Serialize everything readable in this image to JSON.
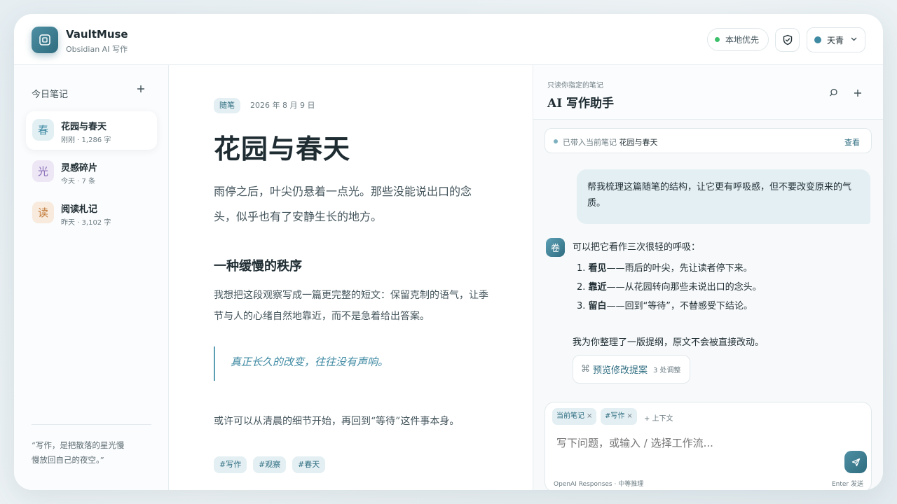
{
  "app": {
    "name": "VaultMuse",
    "subtitle": "Obsidian AI 写作",
    "local_first_label": "本地优先",
    "theme_label": "天青"
  },
  "colors": {
    "accent": "#2f6d80",
    "status_green": "#3cbf6a",
    "tag_bg": "#e3eff3"
  },
  "sidebar": {
    "title": "今日笔记",
    "add_icon": "plus-icon",
    "items": [
      {
        "badge": "春",
        "title": "花园与春天",
        "meta": "刚刚 · 1,286 字",
        "badge_color": "#3f8aa3",
        "badge_bg": "#e2f0f4"
      },
      {
        "badge": "光",
        "title": "灵感碎片",
        "meta": "今天 · 7 条",
        "badge_color": "#8a6fb8",
        "badge_bg": "#ede6f5"
      },
      {
        "badge": "读",
        "title": "阅读札记",
        "meta": "昨天 · 3,102 字",
        "badge_color": "#c27a3a",
        "badge_bg": "#f8eadc"
      }
    ],
    "quote": "“写作，是把散落的星光慢慢放回自己的夜空。”"
  },
  "editor": {
    "category": "随笔",
    "date": "2026 年 8 月 9 日",
    "title": "花园与春天",
    "paragraph1": "雨停之后，叶尖仍悬着一点光。那些没能说出口的念头，似乎也有了安静生长的地方。",
    "heading2": "一种缓慢的秩序",
    "paragraph2": "我想把这段观察写成一篇更完整的短文：保留克制的语气，让季节与人的心绪自然地靠近，而不是急着给出答案。",
    "quote": "真正长久的改变，往往没有声响。",
    "paragraph3": "或许可以从清晨的细节开始，再回到“等待”这件事本身。",
    "tags": [
      "#写作",
      "#观察",
      "#春天"
    ]
  },
  "ai_panel": {
    "subtitle": "只读你指定的笔记",
    "title": "AI 写作助手",
    "context_prefix": "已带入当前笔记",
    "context_note": "花园与春天",
    "view_label": "查看",
    "user_message": "帮我梳理这篇随笔的结构，让它更有呼吸感，但不要改变原来的气质。",
    "bot_avatar": "卷",
    "bot_intro": "可以把它看作三次很轻的呼吸：",
    "bot_points": [
      {
        "num": "1.",
        "key": "看见",
        "text": "——雨后的叶尖，先让读者停下来。"
      },
      {
        "num": "2.",
        "key": "靠近",
        "text": "——从花园转向那些未说出口的念头。"
      },
      {
        "num": "3.",
        "key": "留白",
        "text": "——回到“等待”，不替感受下结论。"
      }
    ],
    "bot_outro": "我为你整理了一版提纲，原文不会被直接改动。",
    "preview_label": "预览修改提案",
    "preview_count": "3 处调整",
    "composer": {
      "chips": [
        "当前笔记",
        "#写作"
      ],
      "add_context": "+ 上下文",
      "placeholder": "写下问题，或输入 / 选择工作流...",
      "model_info": "OpenAI Responses · 中等推理",
      "enter_hint": "Enter 发送"
    }
  }
}
